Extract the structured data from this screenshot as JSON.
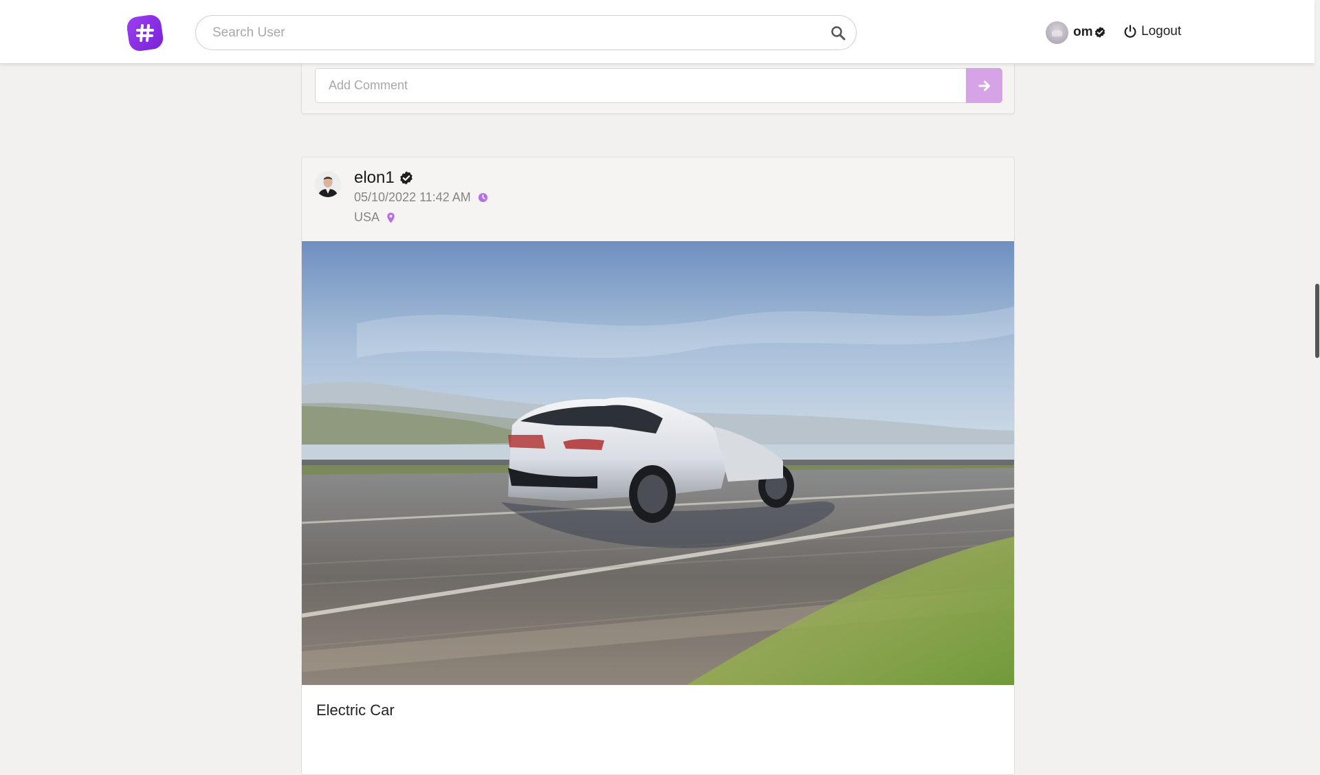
{
  "header": {
    "logo_icon": "hashtag-icon",
    "brand_color": "#8a2be2",
    "search": {
      "placeholder": "Search User",
      "value": ""
    },
    "user": {
      "name": "om",
      "verified": true
    },
    "logout_label": "Logout"
  },
  "previous_post": {
    "comment": {
      "placeholder": "Add Comment",
      "value": ""
    },
    "send_icon": "arrow-right-icon",
    "send_color": "#d6a4e6"
  },
  "post": {
    "author": "elon1",
    "verified": true,
    "timestamp": "05/10/2022 11:42 AM",
    "location": "USA",
    "accent_color": "#b86ee6",
    "caption": "Electric Car"
  }
}
